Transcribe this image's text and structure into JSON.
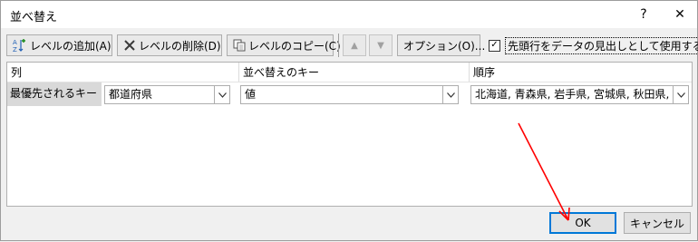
{
  "window": {
    "title": "並べ替え",
    "help_label": "?",
    "close_label": "✕"
  },
  "toolbar": {
    "add_level_label": "レベルの追加(A)",
    "delete_level_label": "レベルの削除(D)",
    "copy_level_label": "レベルのコピー(C)",
    "move_up_label": "▲",
    "move_down_label": "▼",
    "options_label": "オプション(O)...",
    "header_checkbox_label": "先頭行をデータの見出しとして使用する(H)",
    "header_checkbox_checked": true
  },
  "grid": {
    "columns": [
      "列",
      "並べ替えのキー",
      "順序"
    ],
    "rows": [
      {
        "label": "最優先されるキー",
        "column": "都道府県",
        "sort_on": "値",
        "order": "北海道, 青森県, 岩手県, 宮城県, 秋田県, 山"
      }
    ]
  },
  "buttons": {
    "ok_label": "OK",
    "cancel_label": "キャンセル"
  },
  "colors": {
    "annotation_arrow": "#ff0000",
    "default_button_border": "#0078d7"
  }
}
